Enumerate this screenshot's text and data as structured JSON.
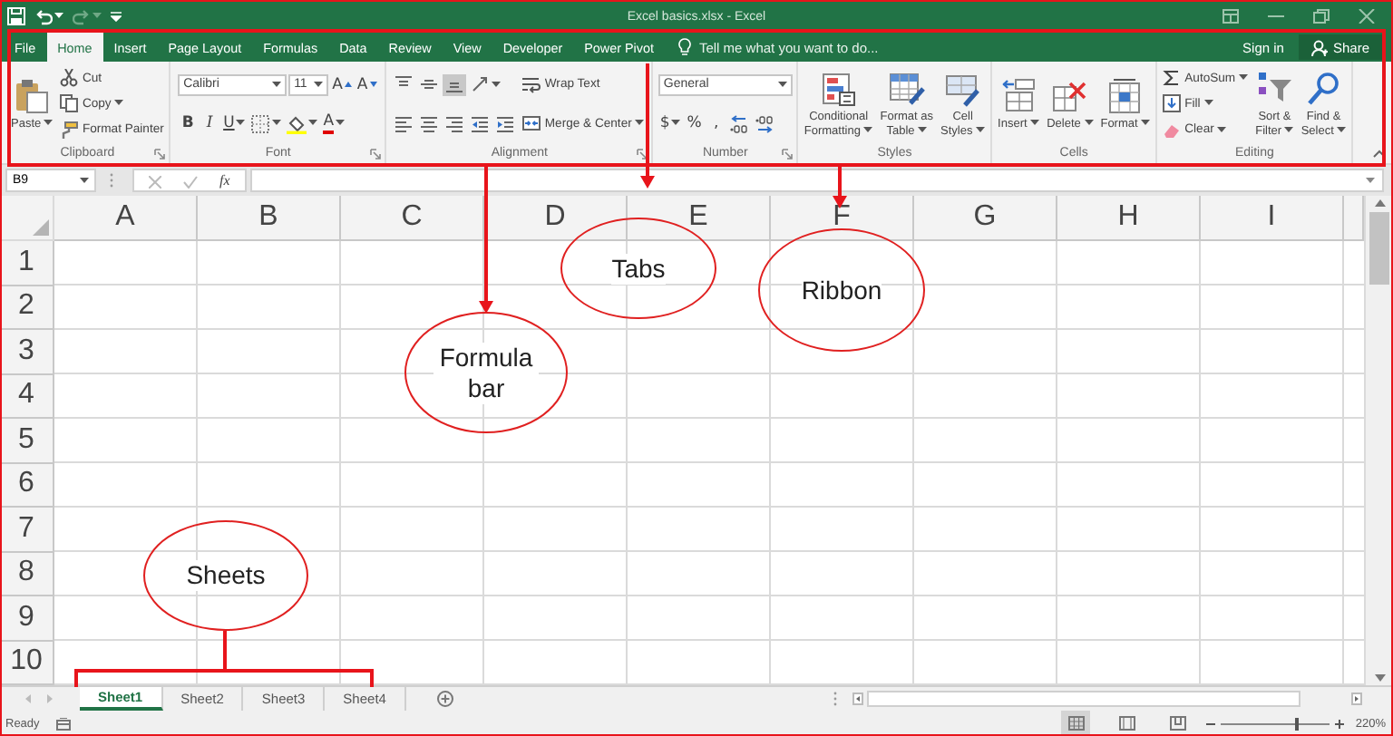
{
  "title_bar": {
    "title": "Excel basics.xlsx - Excel"
  },
  "tabs": [
    {
      "label": "File",
      "selected": false
    },
    {
      "label": "Home",
      "selected": true
    },
    {
      "label": "Insert",
      "selected": false
    },
    {
      "label": "Page Layout",
      "selected": false
    },
    {
      "label": "Formulas",
      "selected": false
    },
    {
      "label": "Data",
      "selected": false
    },
    {
      "label": "Review",
      "selected": false
    },
    {
      "label": "View",
      "selected": false
    },
    {
      "label": "Developer",
      "selected": false
    },
    {
      "label": "Power Pivot",
      "selected": false
    }
  ],
  "tell_me": {
    "placeholder": "Tell me what you want to do..."
  },
  "account": {
    "sign_in": "Sign in",
    "share": "Share"
  },
  "ribbon": {
    "groups": [
      {
        "label": "Clipboard",
        "launcher": true,
        "columns": [
          [
            [
              {
                "kind": "big",
                "label": "Paste",
                "dropdown": true
              }
            ]
          ],
          [
            [
              {
                "kind": "small",
                "label": "Cut",
                "dropdown": false
              }
            ],
            [
              {
                "kind": "small",
                "label": "Copy",
                "dropdown": true
              }
            ],
            [
              {
                "kind": "small",
                "label": "Format Painter",
                "dropdown": false
              }
            ]
          ]
        ]
      },
      {
        "label": "Font",
        "launcher": true,
        "columns": [
          [
            [
              {
                "kind": "combo",
                "value": "Calibri"
              },
              {
                "kind": "combo",
                "value": "11"
              },
              {
                "kind": "grow",
                "label": "A",
                "dropdown": false
              },
              {
                "kind": "shrink",
                "label": "A",
                "dropdown": false
              }
            ],
            [
              {
                "kind": "bold",
                "label": "B",
                "dropdown": false
              },
              {
                "kind": "italic",
                "label": "I",
                "dropdown": false
              },
              {
                "kind": "underline",
                "label": "U",
                "dropdown": true
              },
              {
                "kind": "icon",
                "selected": false,
                "dropdown": true
              },
              {
                "kind": "icon",
                "selected": false,
                "dropdown": true
              },
              {
                "kind": "fontcolor",
                "label": "A",
                "dropdown": true
              }
            ]
          ]
        ]
      },
      {
        "label": "Alignment",
        "launcher": true,
        "columns": [
          [
            [
              {
                "kind": "icon",
                "selected": false,
                "dropdown": false
              },
              {
                "kind": "icon",
                "selected": false,
                "dropdown": false
              },
              {
                "kind": "icon",
                "selected": true,
                "dropdown": false
              },
              {
                "kind": "icon",
                "selected": false,
                "dropdown": true
              }
            ],
            [
              {
                "kind": "icon",
                "selected": false,
                "dropdown": false
              },
              {
                "kind": "icon",
                "selected": false,
                "dropdown": false
              },
              {
                "kind": "icon",
                "selected": false,
                "dropdown": false
              },
              {
                "kind": "icon",
                "selected": false,
                "dropdown": false
              },
              {
                "kind": "icon",
                "selected": false,
                "dropdown": false
              }
            ]
          ],
          [
            [
              {
                "kind": "small",
                "label": "Wrap Text",
                "dropdown": false
              }
            ],
            [
              {
                "kind": "small",
                "label": "Merge & Center",
                "dropdown": true
              }
            ]
          ]
        ]
      },
      {
        "label": "Number",
        "launcher": true,
        "columns": [
          [
            [
              {
                "kind": "combo",
                "value": "General"
              }
            ],
            [
              {
                "kind": "symbol",
                "label": "$",
                "dropdown": true
              },
              {
                "kind": "symbol",
                "label": "%",
                "dropdown": false
              },
              {
                "kind": "symbol",
                "label": ",",
                "dropdown": false
              },
              {
                "kind": "icon",
                "selected": false,
                "dropdown": false
              },
              {
                "kind": "icon",
                "selected": false,
                "dropdown": false
              }
            ]
          ]
        ]
      },
      {
        "label": "Styles",
        "launcher": false,
        "columns": [
          [
            [
              {
                "kind": "big",
                "label": "Conditional\nFormatting",
                "dropdown": true
              }
            ]
          ],
          [
            [
              {
                "kind": "big",
                "label": "Format as\nTable",
                "dropdown": true
              }
            ]
          ],
          [
            [
              {
                "kind": "big",
                "label": "Cell\nStyles",
                "dropdown": true
              }
            ]
          ]
        ]
      },
      {
        "label": "Cells",
        "launcher": false,
        "columns": [
          [
            [
              {
                "kind": "big",
                "label": "Insert",
                "dropdown": true
              }
            ]
          ],
          [
            [
              {
                "kind": "big",
                "label": "Delete",
                "dropdown": true
              }
            ]
          ],
          [
            [
              {
                "kind": "big",
                "label": "Format",
                "dropdown": true
              }
            ]
          ]
        ]
      },
      {
        "label": "Editing",
        "launcher": false,
        "columns": [
          [
            [
              {
                "kind": "small",
                "label": "AutoSum",
                "dropdown": true
              }
            ],
            [
              {
                "kind": "small",
                "label": "Fill",
                "dropdown": true
              }
            ],
            [
              {
                "kind": "small",
                "label": "Clear",
                "dropdown": true
              }
            ]
          ],
          [
            [
              {
                "kind": "big",
                "label": "Sort &\nFilter",
                "dropdown": true
              }
            ]
          ],
          [
            [
              {
                "kind": "big",
                "label": "Find &\nSelect",
                "dropdown": true
              }
            ]
          ]
        ]
      }
    ]
  },
  "formula_bar": {
    "name_box": "B9",
    "function_label": "fx"
  },
  "sheet": {
    "columns": [
      "A",
      "B",
      "C",
      "D",
      "E",
      "F",
      "G",
      "H",
      "I"
    ],
    "rows": [
      "1",
      "2",
      "3",
      "4",
      "5",
      "6",
      "7",
      "8",
      "9",
      "10"
    ]
  },
  "sheet_tabs": [
    {
      "label": "Sheet1",
      "selected": true
    },
    {
      "label": "Sheet2",
      "selected": false
    },
    {
      "label": "Sheet3",
      "selected": false
    },
    {
      "label": "Sheet4",
      "selected": false
    }
  ],
  "status_bar": {
    "status": "Ready",
    "zoom": {
      "level": 0.7,
      "reading": "220%"
    }
  },
  "annotations": [
    {
      "text": "Tabs"
    },
    {
      "text": "Ribbon"
    },
    {
      "text": "Formula bar"
    },
    {
      "text": "Sheets"
    }
  ]
}
